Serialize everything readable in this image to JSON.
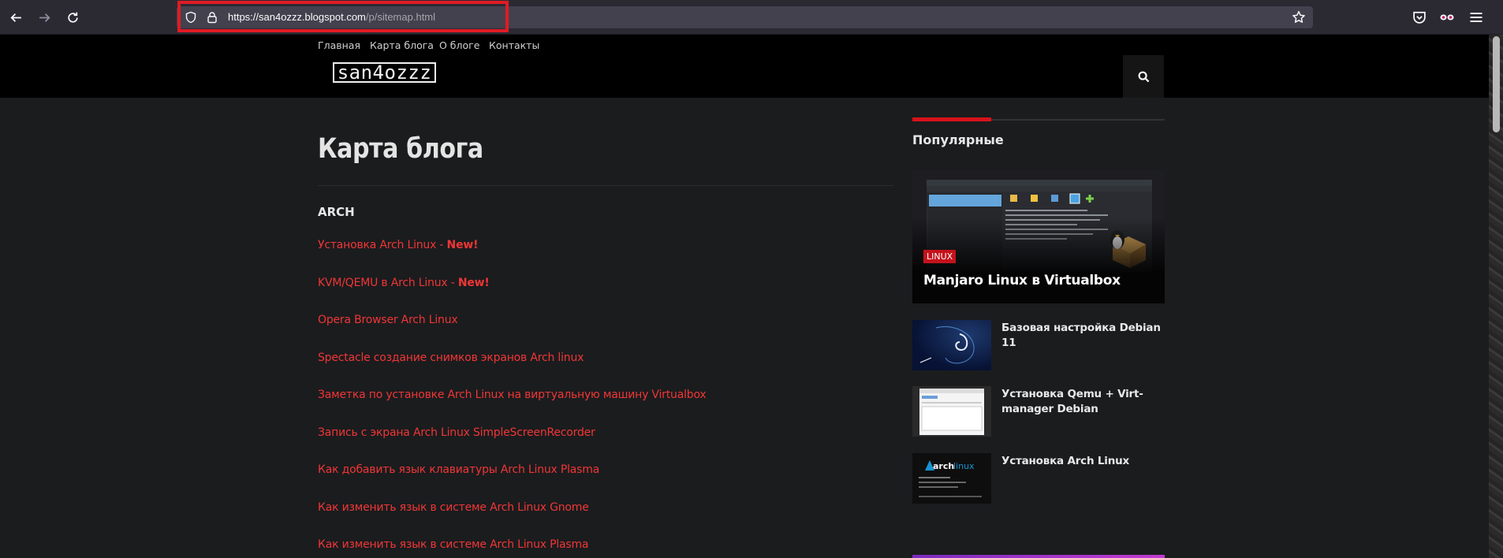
{
  "browser": {
    "url_host": "https://san4ozzz.blogspot.com",
    "url_path": "/p/sitemap.html"
  },
  "topnav": [
    "Главная",
    "Карта блога",
    "О блоге",
    "Контакты"
  ],
  "site": {
    "logo": "san4ozzz"
  },
  "main": {
    "title": "Карта блога",
    "section": "ARCH",
    "posts": [
      {
        "title": "Установка Arch Linux - ",
        "new": "New!"
      },
      {
        "title": "KVM/QEMU в Arch Linux - ",
        "new": "New!"
      },
      {
        "title": "Opera Browser Arch Linux",
        "new": ""
      },
      {
        "title": "Spectacle создание снимков экранов Arch linux",
        "new": ""
      },
      {
        "title": "Заметка по установке Arch Linux на виртуальную машину Virtualbox",
        "new": ""
      },
      {
        "title": "Запись с экрана Arch Linux SimpleScreenRecorder",
        "new": ""
      },
      {
        "title": "Как добавить язык клавиатуры Arch Linux Plasma",
        "new": ""
      },
      {
        "title": "Как изменить язык в системе Arch Linux Gnome",
        "new": ""
      },
      {
        "title": "Как изменить язык в системе Arch Linux Plasma",
        "new": ""
      }
    ]
  },
  "sidebar": {
    "title": "Популярные",
    "featured": {
      "label": "LINUX",
      "title": "Manjaro Linux в Virtualbox"
    },
    "items": [
      {
        "title": "Базовая настройка Debian 11",
        "thumb": "debian-swirl"
      },
      {
        "title": "Установка Qemu + Virt-manager Debian",
        "thumb": "virt-manager-window"
      },
      {
        "title": "Установка Arch Linux",
        "thumb": "archlinux-logo"
      }
    ]
  },
  "colors": {
    "accent_red": "#f03636",
    "bar_red": "#d9121b",
    "page_bg": "#1b1c1e"
  }
}
